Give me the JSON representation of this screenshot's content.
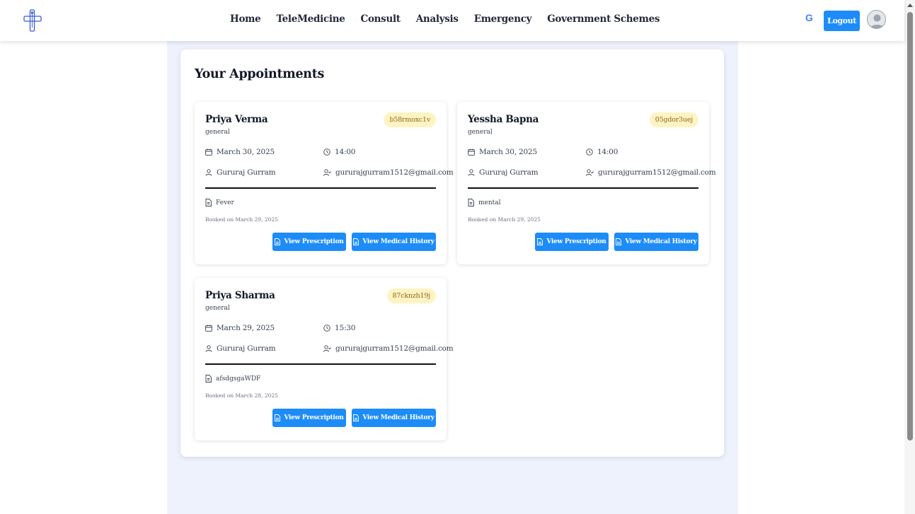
{
  "nav": {
    "links": [
      "Home",
      "TeleMedicine",
      "Consult",
      "Analysis",
      "Emergency",
      "Government Schemes"
    ],
    "google_glyph": "G",
    "logout_label": "Logout"
  },
  "panel": {
    "title": "Your Appointments"
  },
  "appointments": [
    {
      "patient": "Priya Verma",
      "type": "general",
      "id": "b58rmoxc1v",
      "date": "March 30, 2025",
      "time": "14:00",
      "doctor": "Gururaj Gurram",
      "email": "gururajgurram1512@gmail.com",
      "reason": "Fever",
      "booked": "Booked on March 29, 2025",
      "prescription_label": "View Prescription",
      "history_label": "View Medical History"
    },
    {
      "patient": "Yessha Bapna",
      "type": "general",
      "id": "05gdor3uej",
      "date": "March 30, 2025",
      "time": "14:00",
      "doctor": "Gururaj Gurram",
      "email": "gururajgurram1512@gmail.com",
      "reason": "mental",
      "booked": "Booked on March 29, 2025",
      "prescription_label": "View Prescription",
      "history_label": "View Medical History"
    },
    {
      "patient": "Priya Sharma",
      "type": "general",
      "id": "87cknzh19j",
      "date": "March 29, 2025",
      "time": "15:30",
      "doctor": "Gururaj Gurram",
      "email": "gururajgurram1512@gmail.com",
      "reason": "afsdgsgaWDF",
      "booked": "Booked on March 28, 2025",
      "prescription_label": "View Prescription",
      "history_label": "View Medical History"
    }
  ],
  "icons": {
    "logo": "medical-cross-logo-icon",
    "date": "calendar-icon",
    "time": "clock-icon",
    "doctor": "user-icon",
    "email": "user-check-icon",
    "reason": "file-text-icon",
    "button": "file-icon"
  },
  "colors": {
    "accent": "#1d8cf8",
    "badge_bg": "#fdf4c3",
    "badge_text": "#92651a",
    "page_bg": "#eef2fd"
  }
}
